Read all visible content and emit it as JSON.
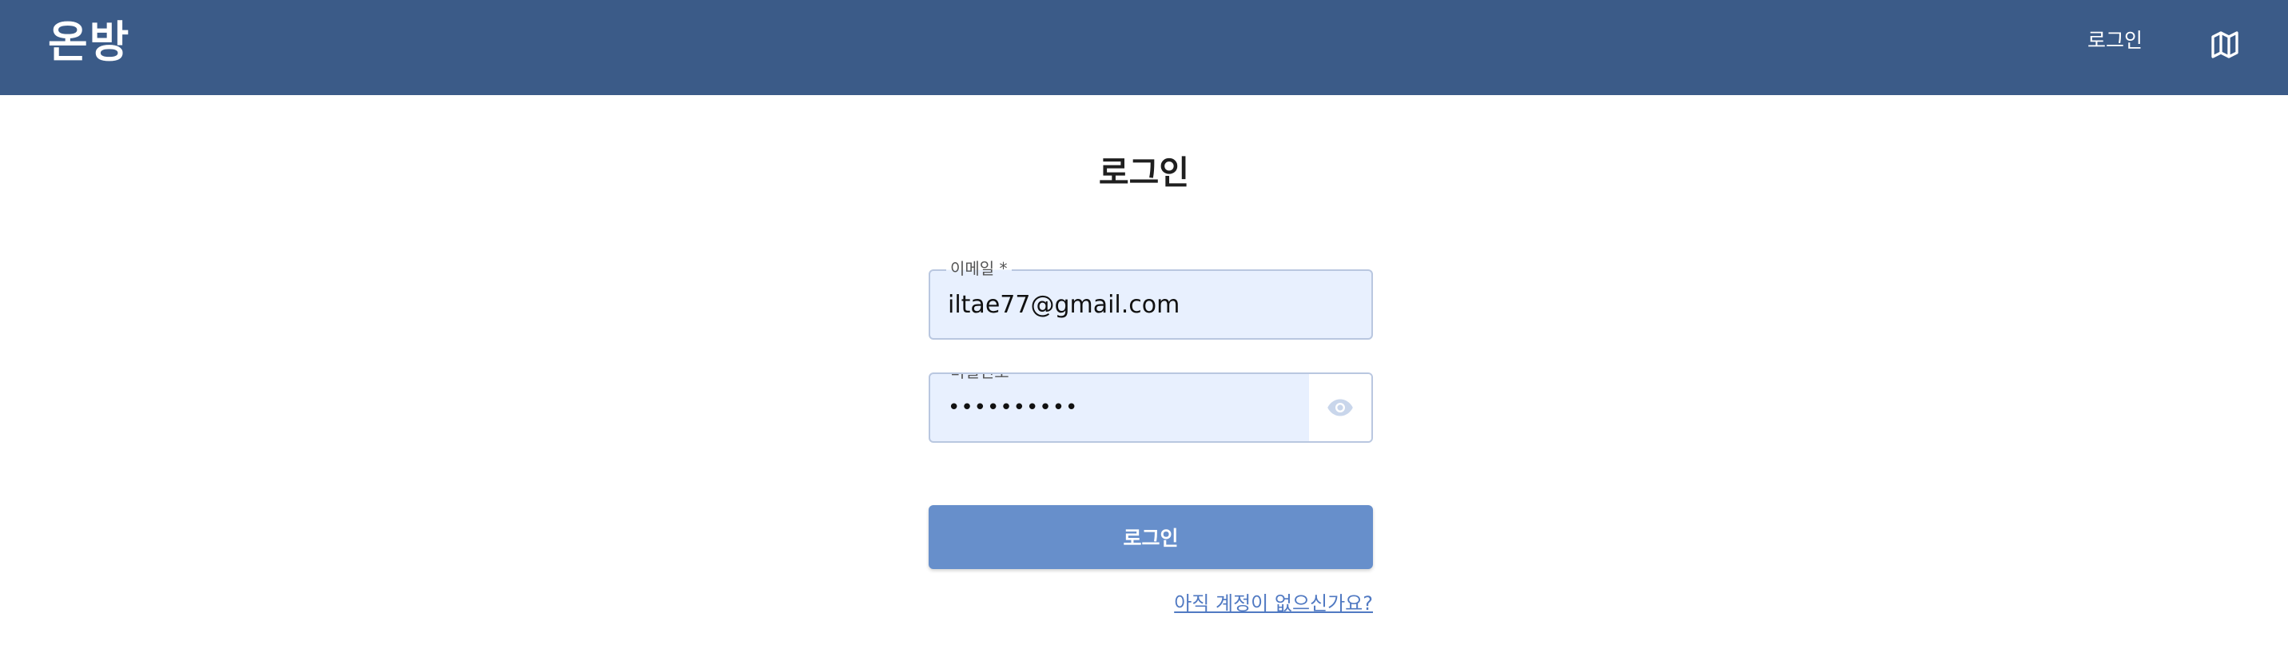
{
  "header": {
    "logo": "온방",
    "nav_login": "로그인",
    "map_icon": "map-icon",
    "background_color": "#3b5b88"
  },
  "page": {
    "title": "로그인"
  },
  "form": {
    "email": {
      "label": "이메일 *",
      "value": "iltae77@gmail.com"
    },
    "password": {
      "label": "비밀번호 *",
      "value": "••••••••••",
      "toggle_icon": "eye-icon"
    },
    "submit_label": "로그인",
    "signup_link": "아직 계정이 없으신가요?",
    "submit_color": "#678fcb",
    "field_background": "#e8f0fe"
  }
}
